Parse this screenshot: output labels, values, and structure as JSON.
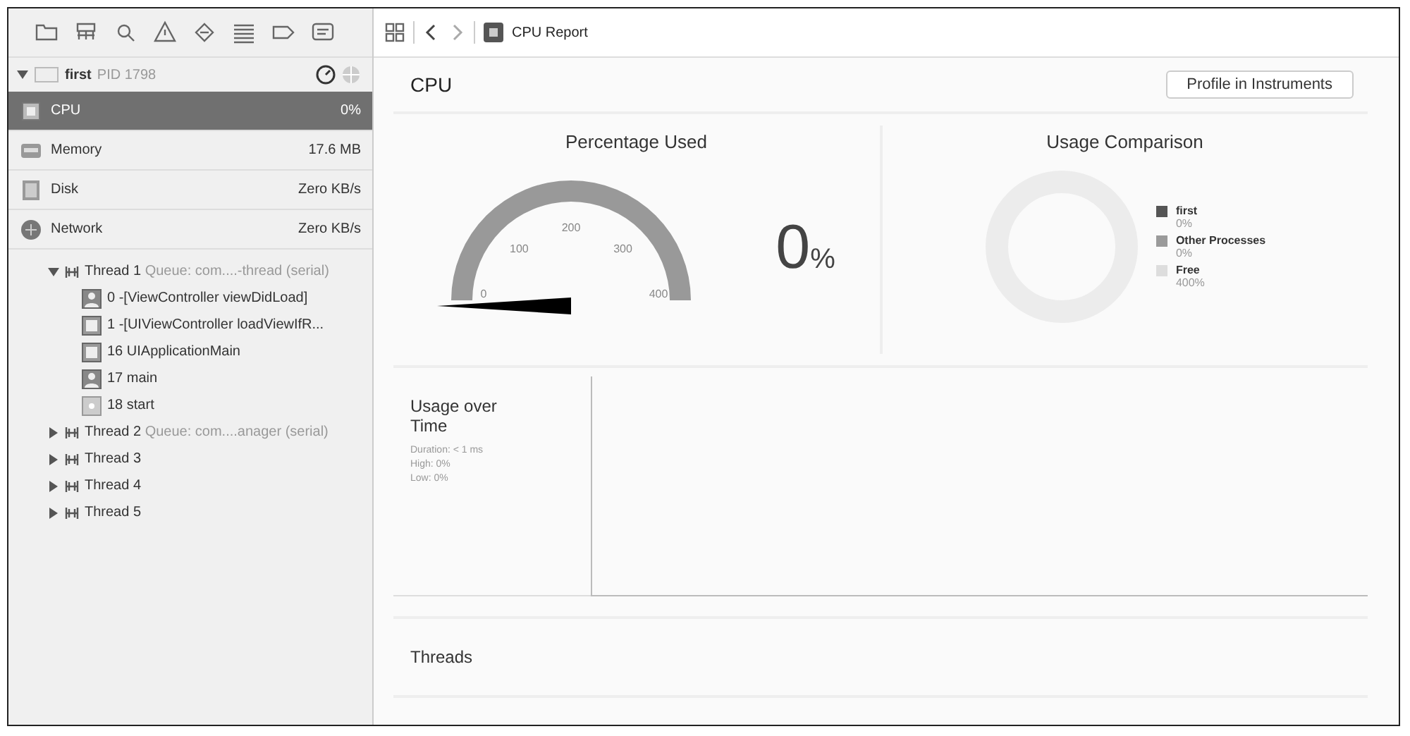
{
  "process": {
    "name": "first",
    "pid": "PID 1798",
    "expanded": true
  },
  "gauges": [
    {
      "name": "CPU",
      "value": "0%",
      "selected": true
    },
    {
      "name": "Memory",
      "value": "17.6 MB",
      "selected": false
    },
    {
      "name": "Disk",
      "value": "Zero KB/s",
      "selected": false
    },
    {
      "name": "Network",
      "value": "Zero KB/s",
      "selected": false
    }
  ],
  "threads": [
    {
      "name": "Thread 1",
      "queue": "Queue: com....-thread (serial)",
      "expanded": true,
      "children": [
        {
          "label": "0 -[ViewController viewDidLoad]",
          "kind": "user"
        },
        {
          "label": "1 -[UIViewController loadViewIfR...",
          "kind": "system"
        },
        {
          "label": "16 UIApplicationMain",
          "kind": "system"
        },
        {
          "label": "17 main",
          "kind": "user"
        },
        {
          "label": "18 start",
          "kind": "start"
        }
      ]
    },
    {
      "name": "Thread 2",
      "queue": "Queue: com....anager (serial)",
      "expanded": false
    },
    {
      "name": "Thread 3",
      "expanded": false
    },
    {
      "name": "Thread 4",
      "expanded": false
    },
    {
      "name": "Thread 5",
      "expanded": false
    }
  ],
  "editor_bar": {
    "title": "CPU Report"
  },
  "report": {
    "title": "CPU",
    "button": "Profile in Instruments",
    "percentage": {
      "title": "Percentage Used",
      "ticks": [
        "0",
        "100",
        "200",
        "300",
        "400"
      ],
      "value": "0",
      "unit": "%"
    },
    "comparison": {
      "title": "Usage Comparison",
      "legend": [
        {
          "name": "first",
          "value": "0%",
          "color": "#555555"
        },
        {
          "name": "Other Processes",
          "value": "0%",
          "color": "#9a9a9a"
        },
        {
          "name": "Free",
          "value": "400%",
          "color": "#dddddd"
        }
      ]
    },
    "usage_over_time": {
      "title": "Usage over Time",
      "stats": [
        "Duration: < 1 ms",
        "High: 0%",
        "Low: 0%"
      ]
    },
    "threads_title": "Threads"
  }
}
